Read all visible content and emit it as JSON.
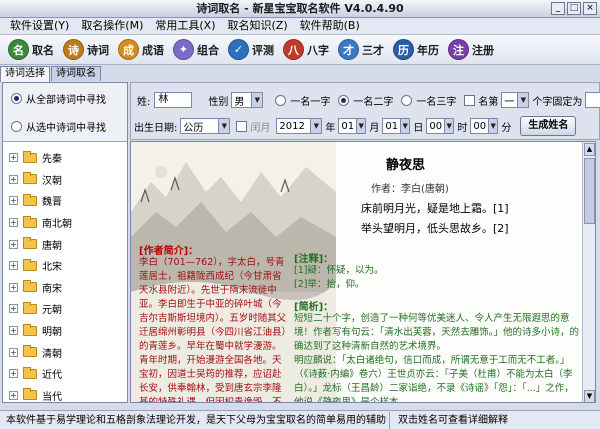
{
  "window": {
    "title": "诗词取名 - 新星宝宝取名软件 V4.0.4.90"
  },
  "menu": [
    "软件设置(Y)",
    "取名操作(M)",
    "常用工具(X)",
    "取名知识(Z)",
    "软件帮助(B)"
  ],
  "toolbar": [
    {
      "label": "取名",
      "icon": "name-icon",
      "color": "#3a8a3a",
      "glyph": "名"
    },
    {
      "label": "诗词",
      "icon": "scroll-icon",
      "color": "#c07a18",
      "glyph": "诗"
    },
    {
      "label": "成语",
      "icon": "book-icon",
      "color": "#d68d1a",
      "glyph": "成"
    },
    {
      "label": "组合",
      "icon": "star-icon",
      "color": "#7a6bc4",
      "glyph": "✦"
    },
    {
      "label": "评测",
      "icon": "check-icon",
      "color": "#2e6fbf",
      "glyph": "✓"
    },
    {
      "label": "八字",
      "icon": "clock-icon",
      "color": "#c03a2a",
      "glyph": "八"
    },
    {
      "label": "三才",
      "icon": "people-icon",
      "color": "#3b79c4",
      "glyph": "才"
    },
    {
      "label": "年历",
      "icon": "calendar-icon",
      "color": "#2a5fa8",
      "glyph": "历"
    },
    {
      "label": "注册",
      "icon": "register-icon",
      "color": "#7a3fa8",
      "glyph": "注"
    }
  ],
  "tabs": [
    "诗词选择",
    "诗词取名"
  ],
  "search_scope": {
    "option_all": "从全部诗词中寻找",
    "option_selected": "从选中诗词中寻找"
  },
  "dynasties": [
    "先秦",
    "汉朝",
    "魏晋",
    "南北朝",
    "唐朝",
    "北宋",
    "南宋",
    "元朝",
    "明朝",
    "清朝",
    "近代",
    "当代"
  ],
  "form": {
    "surname_label": "姓:",
    "surname_value": "林",
    "gender_label": "性别",
    "gender_value": "男",
    "one_char": "一名一字",
    "two_char": "一名二字",
    "three_char": "一名三字",
    "fixed_label": "名第",
    "fixed_pos": "一",
    "fixed_suffix": "个字固定为",
    "fixed_value": "",
    "birth_label": "出生日期:",
    "calendar": "公历",
    "leap_label": "闰月",
    "year": "2012",
    "year_label": "年",
    "month": "01",
    "month_label": "月",
    "day": "01",
    "day_label": "日",
    "hour": "00",
    "hour_label": "时",
    "minute": "00",
    "minute_label": "分",
    "generate_button": "生成姓名"
  },
  "poem": {
    "title": "静夜思",
    "author": "作者：李白(唐朝)",
    "lines": [
      "床前明月光，疑是地上霜。[1]",
      "举头望明月，低头思故乡。[2]"
    ]
  },
  "author_intro": {
    "heading": "[作者简介]：",
    "text": "李白（701—762），字太白，号青莲居士，祖籍陇西成纪（今甘肃省天水县附近）。先世于隋末流徙中亚。李白即生于中亚的碎叶城（今吉尔吉斯斯坦境内）。五岁时随其父迁居绵州彰明县（今四川省江油县）的青莲乡。早年在蜀中就学漫游。青年时期，开始漫游全国各地。天宝初，因道士吴筠的推荐，应诏赴长安，供奉翰林，受到唐玄宗李隆基的特殊礼遇。但因权贵谗毁，不到二年即遭谗去职，长期漂泊。天宝十四年（755）安史之乱起，他隐居庐山，但仍不忘拯救国家"
  },
  "notes": {
    "heading": "[注释]：",
    "items": [
      "[1]疑：怀疑，以为。",
      "[2]举：抬，仰。"
    ]
  },
  "appreciation": {
    "heading": "[简析]：",
    "text": "短短二十个字，创造了一种何等优美迷人、令人产生无限遐思的意境！作者写有句云：「清水出芙蓉，天然去雕饰。」他的诗多小诗，的确达到了这种清新自然的艺术境界。",
    "text2": "明应麟说：「太白诸绝句，信口而成，所谓无意于工而无不工者。」（《诗薮·内编》卷六）王世贞亦云：「子美（杜甫）不能为太白（李白）。」龙标（王昌龄）二家诣绝，不录《诗谣》「怨」：「...」之作，他说《静夜思》是个样本。"
  },
  "status": {
    "left": "本软件基于易学理论和五格剖象法理论开发，是天下父母为宝宝取名的简单易用的辅助工具。",
    "right": "双击姓名可查看详细解释"
  }
}
